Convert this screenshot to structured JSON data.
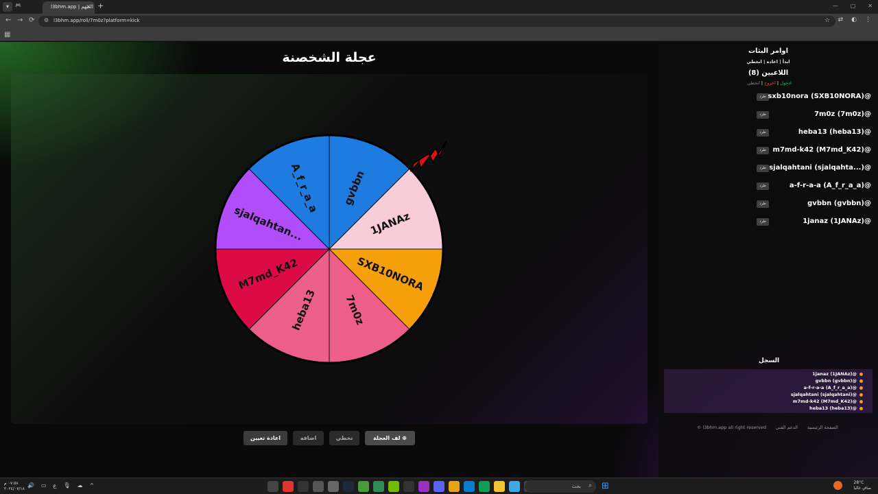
{
  "browser": {
    "tab_gray": "🎮",
    "tab_title": "l3bhm.app | العبهم",
    "tab_close": "×",
    "new_tab": "+",
    "url": "l3bhm.app/roll/7m0z?platform=kick",
    "back": "←",
    "forward": "→",
    "reload": "⟳",
    "star": "☆"
  },
  "page": {
    "title": "عجلة الشخصنة"
  },
  "wheel": {
    "segments": [
      {
        "label": "gvbbn",
        "color": "#1e7be0"
      },
      {
        "label": "1JANAz",
        "color": "#f9ccd9"
      },
      {
        "label": "SXB10NORA",
        "color": "#f5a00b"
      },
      {
        "label": "7m0z",
        "color": "#ec5f8a"
      },
      {
        "label": "heba13",
        "color": "#ec5f8a"
      },
      {
        "label": "M7md_K42",
        "color": "#dc0a45"
      },
      {
        "label": "sjalqahtan...",
        "color": "#b14dfa"
      },
      {
        "label": "A_f_r_a_a",
        "color": "#1e7be0"
      }
    ]
  },
  "controls": {
    "reset": "اعادة تعيين",
    "add": "اضافه",
    "skip": "تخطي",
    "spin": "لف العجلة ⊕"
  },
  "sidebar": {
    "title": "اوامر البثات",
    "commands": "ابدأ | اعاده | انخطي",
    "players_title": "اللاعبين (8)",
    "join": "ادخول",
    "sep1": " | ",
    "leave": "اخروج",
    "sep2": " | ",
    "skip": "انخطي",
    "kick_label": "طرد",
    "players": [
      "sxb10nora (SXB10NORA)@",
      "7m0z (7m0z)@",
      "heba13 (heba13)@",
      "m7md-k42 (M7md_K42)@",
      "sjalqahtani (sjalqahta...)@",
      "a-f-r-a-a (A_f_r_a_a)@",
      "gvbbn (gvbbn)@",
      "1janaz (1JANAz)@"
    ],
    "log_title": "السجل",
    "log": [
      "1janaz (1JANAz)@",
      "gvbbn (gvbbn)@",
      "a-f-r-a-a (A_f_r_a_a)@",
      "sjalqahtani (sjalqahtani)@",
      "m7md-k42 (M7md_K42)@",
      "heba13 (heba13)@"
    ],
    "footer": {
      "home": "الصفحة الرئيسية",
      "support": "الدعم الفني",
      "rights": "l3bhm.app all right reserved ©"
    }
  },
  "taskbar": {
    "time": "٠٧:٥٨ م",
    "date": "٢٠٢٤/٠٧/١٨",
    "lang": "ع",
    "search": "بحث",
    "temp": "28°C",
    "weather": "صافٍ غالبا"
  }
}
